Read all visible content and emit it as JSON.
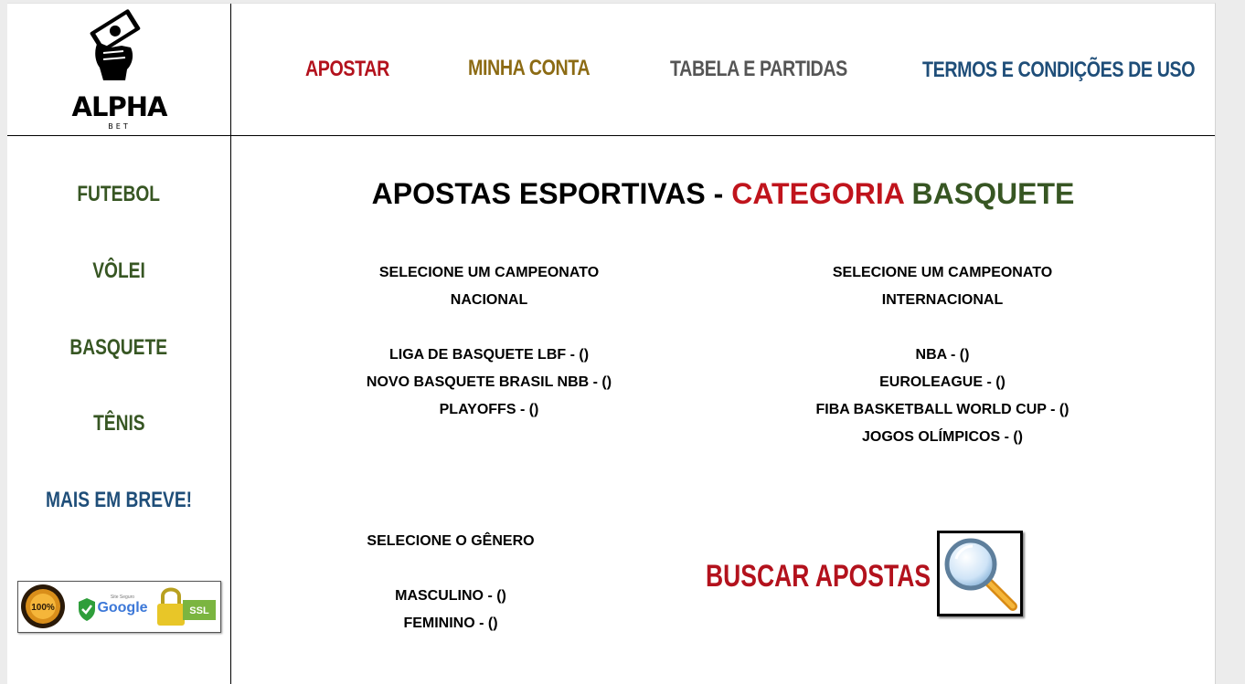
{
  "logo": {
    "name": "ALPHA",
    "sub": "BET"
  },
  "nav": [
    {
      "label": "APOSTAR",
      "color": "#b3121d"
    },
    {
      "label": "MINHA CONTA",
      "color": "#8c6b14"
    },
    {
      "label": "TABELA E PARTIDAS",
      "color": "#555555"
    },
    {
      "label": "TERMOS E CONDIÇÕES DE USO",
      "color": "#1f4e79"
    }
  ],
  "sidebar": {
    "items": [
      {
        "label": "FUTEBOL"
      },
      {
        "label": "VÔLEI"
      },
      {
        "label": "BASQUETE"
      },
      {
        "label": "TÊNIS"
      },
      {
        "label": "MAIS EM BREVE!"
      }
    ],
    "seals": {
      "badge": "100%",
      "google": "Google",
      "google_small": "Site Seguro",
      "ssl": "SSL"
    }
  },
  "main": {
    "title_prefix": "APOSTAS ESPORTIVAS - ",
    "title_category": "CATEGORIA",
    "title_sport": "BASQUETE",
    "nacional": {
      "heading1": "SELECIONE UM CAMPEONATO",
      "heading2": "NACIONAL",
      "options": [
        "LIGA DE BASQUETE LBF - ()",
        "NOVO BASQUETE BRASIL NBB - ()",
        "PLAYOFFS - ()"
      ]
    },
    "internacional": {
      "heading1": "SELECIONE UM CAMPEONATO",
      "heading2": "INTERNACIONAL",
      "options": [
        "NBA - ()",
        "EUROLEAGUE - ()",
        "FIBA BASKETBALL WORLD CUP - ()",
        "JOGOS OLÍMPICOS - ()"
      ]
    },
    "genero": {
      "heading": "SELECIONE O GÊNERO",
      "options": [
        "MASCULINO - ()",
        "FEMININO - ()"
      ]
    },
    "buscar_label": "BUSCAR APOSTAS",
    "search_icon": "magnifier-icon"
  }
}
